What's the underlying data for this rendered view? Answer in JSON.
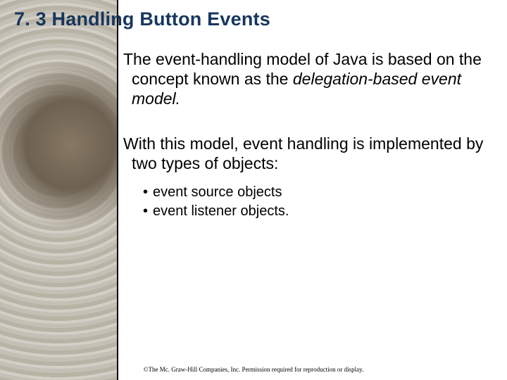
{
  "slide": {
    "title": "7. 3 Handling Button Events",
    "para1_a": "The event-handling model of Java is based on the concept known as the ",
    "para1_italic": "delegation-based event model.",
    "para2": "With this model, event handling is implemented by two types of objects:",
    "bullets": [
      "event source objects",
      "event listener objects."
    ],
    "footer": "©The Mc. Graw-Hill Companies, Inc. Permission required for reproduction or display."
  }
}
